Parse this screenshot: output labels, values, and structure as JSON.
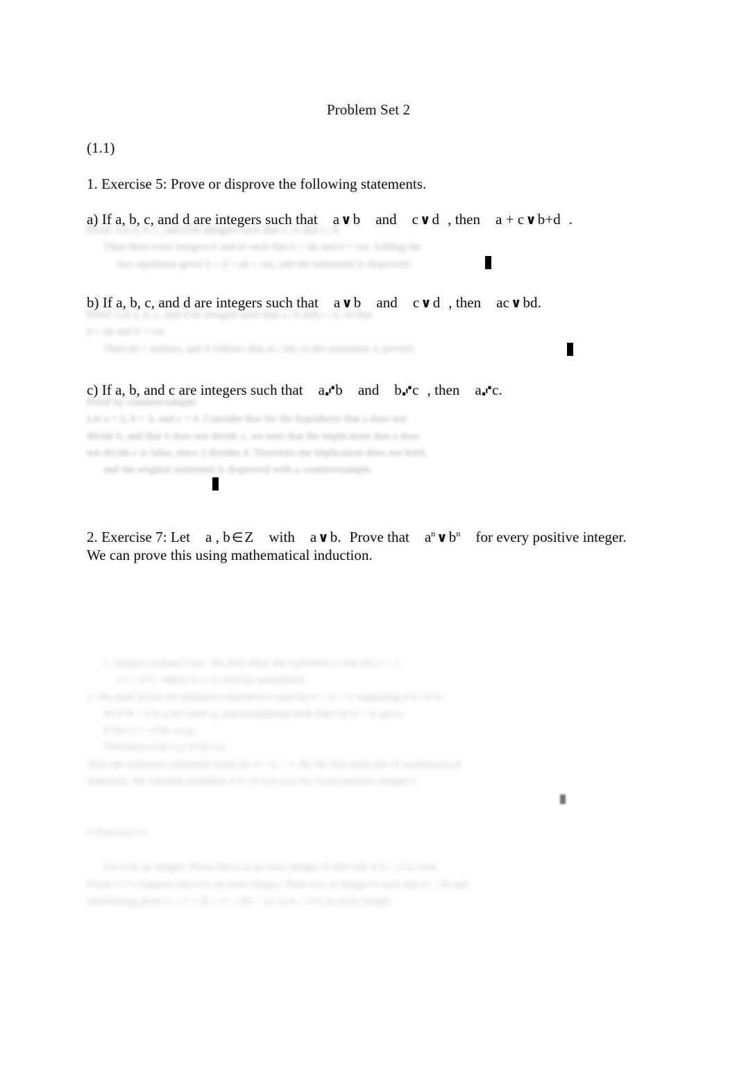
{
  "document": {
    "title": "Problem Set 2",
    "section_label": "(1.1)",
    "exercise_1": {
      "heading": "1. Exercise 5: Prove or disprove the following statements.",
      "items": [
        {
          "label": "a) If a, b, c, and d are integers such that",
          "hyp1_left": "a",
          "hyp1_op": "divides",
          "hyp1_right": "b",
          "conj": "and",
          "hyp2_left": "c",
          "hyp2_op": "divides",
          "hyp2_right": "d",
          "then": ", then",
          "concl_left": "a + c",
          "concl_op": "divides",
          "concl_right": "b+d",
          "terminator": "."
        },
        {
          "label": "b) If a, b, c, and d are integers such that",
          "hyp1_left": "a",
          "hyp1_op": "divides",
          "hyp1_right": "b",
          "conj": "and",
          "hyp2_left": "c",
          "hyp2_op": "divides",
          "hyp2_right": "d",
          "then": ", then",
          "concl_left": "ac",
          "concl_op": "divides",
          "concl_right": "bd",
          "terminator": "."
        },
        {
          "label": "c) If a, b, and c are integers such that",
          "hyp1_left": "a",
          "hyp1_op": "does-not-divide",
          "hyp1_right": "b",
          "conj": "and",
          "hyp2_left": "b",
          "hyp2_op": "does-not-divide",
          "hyp2_right": "c",
          "then": ", then",
          "concl_left": "a",
          "concl_op": "does-not-divide",
          "concl_right": "c",
          "terminator": "."
        }
      ]
    },
    "exercise_2": {
      "prefix": "2. Exercise 7: Let",
      "vars": "a , b",
      "member_symbol": "∈",
      "set": "Z",
      "with": "with",
      "hyp_left": "a",
      "hyp_op": "divides",
      "hyp_right": "b",
      "hyp_terminator": ".",
      "prove": "Prove that",
      "concl_base_left": "a",
      "concl_exp_left": "n",
      "concl_op": "divides",
      "concl_base_right": "b",
      "concl_exp_right": "n",
      "tail": "for every positive integer.",
      "line2": "We can prove this using mathematical induction."
    },
    "symbols": {
      "divides": "∨",
      "does_not_divide": "⑇",
      "qed": "■"
    },
    "redacted_blocks": [
      {
        "id": "proof-a",
        "state": "blurred-illegible",
        "lines": [
          "Proof: Let a, b, c, and d be integers such that a | b and c | d.",
          "Then there exist integers k and m such that b = ak and d = cm. Adding the",
          "two equations gives b + d = ak + cm, and the statement is disproved."
        ]
      },
      {
        "id": "proof-b",
        "state": "blurred-illegible",
        "lines": [
          "Proof: Let a, b, c, and d be integers such that a | b and c | d, so that",
          "b = ak and d = cm.",
          "Then bd = ac(km), and it follows that ac | bd, so the statement is proved."
        ]
      },
      {
        "id": "proof-c",
        "state": "blurred-illegible",
        "lines": [
          "Proof by counterexample:",
          "Let a = 2, b = 3, and c = 4. Consider that for the hypothesis that a does not",
          "divide b, and that b does not divide c, we note that the implication that a does",
          "not divide c is false, since 2 divides 4. Therefore the implication does not hold,",
          "and the original statement is disproved with a counterexample."
        ]
      },
      {
        "id": "proof-ex7",
        "state": "blurred-illegible",
        "lines": [
          "1. Subject to Base Case: We first show the statement is true for n = 1,",
          "a^1 | b^1, which is a | b, true by assumption.",
          "2. We must prove the inductive statement is true for n = k + 1, supposing a^k | b^k.",
          "So b^k = a^k q for some q, and multiplying both sides by b = ar gives",
          "b^(k+1) = a^(k+1) qr.",
          "Therefore a^(k+1) | b^(k+1).",
          "Thus the inductive statement holds for n = k + 1. By the first principle of mathematical",
          "induction, the claimed statement a^n | b^n is true for every positive integer n."
        ]
      },
      {
        "id": "exercise-11-block",
        "state": "blurred-illegible",
        "lines": [
          "3. Exercise 11",
          "Let n be an integer. Prove that n is an even integer if and only if n + 2 is even.",
          "Proof: (=>) Suppose that n is an even integer. Then n is an integer k such that n = 2k and",
          "substituting gives n + 2 = 2k + 2 = 2(k + 1), so n + 2 is an even integer."
        ]
      }
    ]
  }
}
